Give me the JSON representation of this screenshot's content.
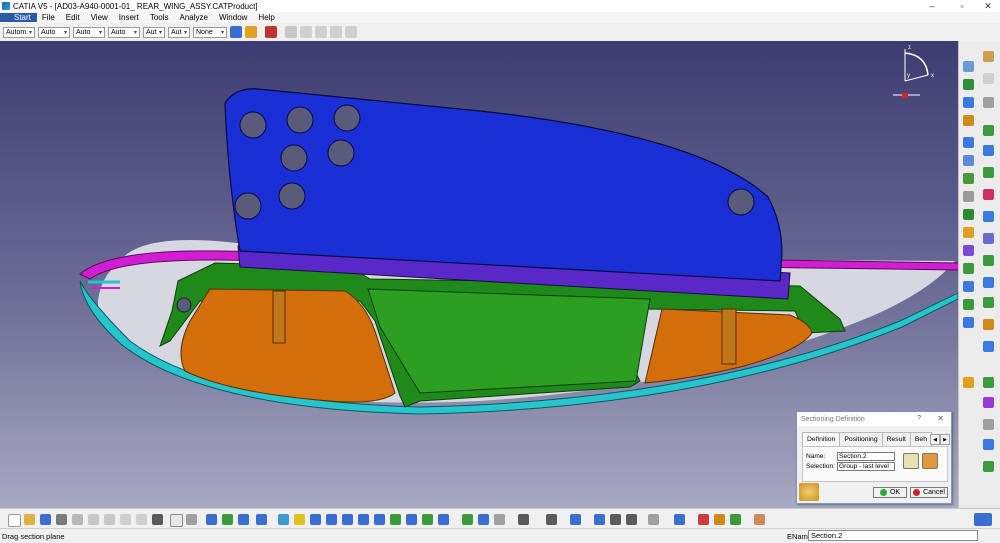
{
  "app": {
    "window_title": "CATIA V5 - [AD03-A940-0001-01_ REAR_WING_ASSY.CATProduct]"
  },
  "window_controls": [
    "–",
    "▫",
    "✕"
  ],
  "menu": [
    "Start",
    "File",
    "Edit",
    "View",
    "Insert",
    "Tools",
    "Analyze",
    "Window",
    "Help"
  ],
  "toolbar": {
    "combos": [
      "Autom.",
      "Auto",
      "Auto",
      "Auto",
      "Aut",
      "Aut",
      "None"
    ]
  },
  "compass": {
    "z": "z",
    "y": "y",
    "x": "x"
  },
  "dialog": {
    "title": "Sectioning Definition",
    "help": "?",
    "close": "✕",
    "tabs": [
      "Definition",
      "Positioning",
      "Result",
      "Beh"
    ],
    "name_label": "Name:",
    "name_value": "Section.2",
    "selection_label": "Selection:",
    "selection_value": "Group - last level",
    "ok": "OK",
    "cancel": "Cancel"
  },
  "status": {
    "message": "Drag section plane",
    "ename_label": "EName",
    "ename_value": "Section.2"
  },
  "colors": {
    "viewport_top": "#3c3c72",
    "viewport_bottom": "#a9a9c2",
    "wing_blue": "#1b2fd6",
    "magenta": "#d21ed2",
    "green": "#1f8a1a",
    "orange": "#d46e0a",
    "cyan": "#26c4cc",
    "selection_blue": "#2a5aa8"
  }
}
